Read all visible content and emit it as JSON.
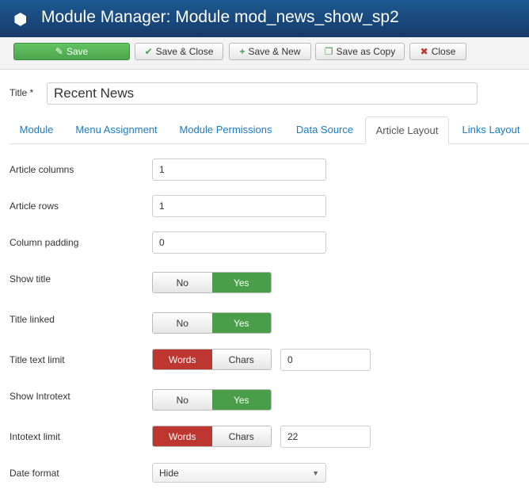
{
  "header": {
    "title": "Module Manager: Module mod_news_show_sp2",
    "icon": "cube-icon"
  },
  "toolbar": {
    "save": "Save",
    "save_close": "Save & Close",
    "save_new": "Save & New",
    "save_copy": "Save as Copy",
    "close": "Close"
  },
  "title_field": {
    "label": "Title *",
    "value": "Recent News"
  },
  "tabs": [
    "Module",
    "Menu Assignment",
    "Module Permissions",
    "Data Source",
    "Article Layout",
    "Links Layout"
  ],
  "active_tab": "Article Layout",
  "fields": {
    "article_columns": {
      "label": "Article columns",
      "value": "1"
    },
    "article_rows": {
      "label": "Article rows",
      "value": "1"
    },
    "column_padding": {
      "label": "Column padding",
      "value": "0"
    },
    "show_title": {
      "label": "Show title",
      "options": [
        "No",
        "Yes"
      ],
      "selected": "Yes"
    },
    "title_linked": {
      "label": "Title linked",
      "options": [
        "No",
        "Yes"
      ],
      "selected": "Yes"
    },
    "title_text_limit": {
      "label": "Title text limit",
      "options": [
        "Words",
        "Chars"
      ],
      "selected": "Words",
      "value": "0"
    },
    "show_introtext": {
      "label": "Show Introtext",
      "options": [
        "No",
        "Yes"
      ],
      "selected": "Yes"
    },
    "introtext_limit": {
      "label": "Intotext limit",
      "options": [
        "Words",
        "Chars"
      ],
      "selected": "Words",
      "value": "22"
    },
    "date_format": {
      "label": "Date format",
      "value": "Hide"
    }
  }
}
